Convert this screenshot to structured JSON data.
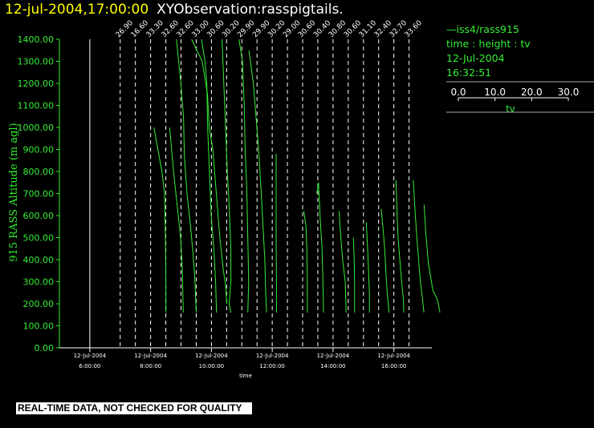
{
  "header": {
    "date_time": "12-jul-2004,17:00:00",
    "observation": "XYObservation:rasspigtails."
  },
  "legend": {
    "series_label": "iss4/rass915",
    "axes_desc": "time : height : tv",
    "date": "12-Jul-2004",
    "time": "16:32:51",
    "scale_ticks": [
      "0.0",
      "10.0",
      "20.0",
      "30.0"
    ],
    "scale_label": "tv"
  },
  "warning": "REAL-TIME DATA, NOT CHECKED FOR QUALITY",
  "colors": {
    "background": "#000000",
    "axes": "#33ee33",
    "data": "#33ee33",
    "header_date": "#ffff00",
    "text": "#ffffff"
  },
  "chart_data": {
    "type": "line",
    "title": "12-jul-2004,17:00:00 XYObservation:rasspigtails.",
    "xlabel": "time",
    "ylabel": "915 RASS Altitude (m agl)",
    "ylim": [
      0,
      1400
    ],
    "y_ticks": [
      "0.00",
      "100.00",
      "200.00",
      "300.00",
      "400.00",
      "500.00",
      "600.00",
      "700.00",
      "800.00",
      "900.00",
      "1000.00",
      "1100.00",
      "1200.00",
      "1300.00",
      "1400.00"
    ],
    "xlim": [
      "05:00",
      "17:15"
    ],
    "x_ticks": [
      {
        "date": "12-Jul-2004",
        "time": "6:00:00"
      },
      {
        "date": "12-Jul-2004",
        "time": "8:00:00"
      },
      {
        "date": "12-Jul-2004",
        "time": "10:00:00"
      },
      {
        "date": "12-Jul-2004",
        "time": "12:00:00"
      },
      {
        "date": "12-Jul-2004",
        "time": "14:00:00"
      },
      {
        "date": "12-Jul-2004",
        "time": "16:00:00"
      }
    ],
    "reference_line_time": "06:00",
    "profiles": [
      {
        "time": "07:00",
        "label": "26.90",
        "points": []
      },
      {
        "time": "07:30",
        "label": "16.60",
        "points": [
          [
            10.5,
            1000
          ],
          [
            15,
            800
          ],
          [
            16.5,
            700
          ],
          [
            17,
            500
          ],
          [
            17.2,
            350
          ],
          [
            17.3,
            160
          ]
        ]
      },
      {
        "time": "08:00",
        "label": "33.30",
        "points": [
          [
            10.8,
            1000
          ],
          [
            13,
            800
          ],
          [
            15,
            650
          ],
          [
            17,
            500
          ],
          [
            18,
            350
          ],
          [
            18.5,
            160
          ]
        ]
      },
      {
        "time": "08:30",
        "label": "32.60",
        "points": [
          [
            6,
            1400
          ],
          [
            8.5,
            1200
          ],
          [
            10,
            1050
          ],
          [
            10.5,
            870
          ],
          [
            12,
            700
          ],
          [
            14,
            550
          ],
          [
            15.5,
            420
          ],
          [
            16.5,
            300
          ],
          [
            17.2,
            160
          ]
        ]
      },
      {
        "time": "09:00",
        "label": "32.60",
        "points": [
          [
            6,
            1400
          ],
          [
            12,
            1300
          ],
          [
            15,
            1150
          ],
          [
            16,
            1000
          ],
          [
            18,
            900
          ],
          [
            20,
            700
          ],
          [
            22,
            500
          ],
          [
            24,
            350
          ],
          [
            25,
            300
          ],
          [
            26,
            200
          ]
        ]
      },
      {
        "time": "09:30",
        "label": "33.00",
        "points": [
          [
            3,
            1400
          ],
          [
            5,
            1300
          ],
          [
            6,
            1200
          ],
          [
            6.5,
            1000
          ],
          [
            7.5,
            800
          ],
          [
            8.5,
            600
          ],
          [
            10,
            450
          ],
          [
            11,
            300
          ],
          [
            11.5,
            160
          ]
        ]
      },
      {
        "time": "10:00",
        "label": "30.60",
        "points": [
          [
            6,
            1400
          ],
          [
            7,
            1200
          ],
          [
            8,
            1000
          ],
          [
            9,
            800
          ],
          [
            10,
            650
          ],
          [
            11,
            450
          ],
          [
            11,
            300
          ],
          [
            10,
            200
          ],
          [
            11,
            160
          ]
        ]
      },
      {
        "time": "10:30",
        "label": "30.20",
        "points": [
          [
            7,
            1400
          ],
          [
            9,
            1300
          ],
          [
            10,
            1100
          ],
          [
            10.5,
            900
          ],
          [
            11.5,
            700
          ],
          [
            12,
            500
          ],
          [
            12.5,
            300
          ],
          [
            12,
            160
          ]
        ]
      },
      {
        "time": "11:00",
        "label": "29.90",
        "points": [
          [
            4,
            1350
          ],
          [
            6.5,
            1200
          ],
          [
            8,
            1050
          ],
          [
            9.5,
            900
          ],
          [
            11,
            700
          ],
          [
            12,
            550
          ],
          [
            13,
            400
          ],
          [
            13.5,
            250
          ],
          [
            14,
            160
          ]
        ]
      },
      {
        "time": "11:30",
        "label": "29.90",
        "points": [
          [
            10.8,
            880
          ],
          [
            10.8,
            700
          ],
          [
            10.8,
            500
          ],
          [
            11,
            300
          ],
          [
            11,
            160
          ]
        ]
      },
      {
        "time": "12:00",
        "label": "30.20",
        "points": []
      },
      {
        "time": "12:30",
        "label": "29.00",
        "points": [
          [
            9.3,
            620
          ],
          [
            10.5,
            550
          ],
          [
            11,
            450
          ],
          [
            11.2,
            350
          ],
          [
            11.3,
            160
          ]
        ]
      },
      {
        "time": "13:00",
        "label": "30.60",
        "points": [
          [
            8,
            700
          ],
          [
            9,
            750
          ],
          [
            10,
            580
          ],
          [
            11,
            450
          ],
          [
            11.5,
            300
          ],
          [
            11.8,
            160
          ]
        ]
      },
      {
        "time": "13:30",
        "label": "30.40",
        "points": [
          [
            12,
            620
          ],
          [
            13,
            500
          ],
          [
            14,
            400
          ],
          [
            15.5,
            300
          ],
          [
            16,
            160
          ]
        ]
      },
      {
        "time": "14:00",
        "label": "30.80",
        "points": [
          [
            11.5,
            500
          ],
          [
            12,
            400
          ],
          [
            12.2,
            300
          ],
          [
            12.2,
            160
          ]
        ]
      },
      {
        "time": "14:30",
        "label": "30.60",
        "points": [
          [
            10.2,
            570
          ],
          [
            11,
            450
          ],
          [
            11.5,
            350
          ],
          [
            12,
            250
          ],
          [
            12,
            160
          ]
        ]
      },
      {
        "time": "15:00",
        "label": "31.10",
        "points": [
          [
            10,
            630
          ],
          [
            11,
            550
          ],
          [
            12,
            450
          ],
          [
            13,
            300
          ],
          [
            14,
            200
          ],
          [
            14.5,
            160
          ]
        ]
      },
      {
        "time": "15:30",
        "label": "32.40",
        "points": [
          [
            9.8,
            760
          ],
          [
            10.5,
            600
          ],
          [
            11,
            500
          ],
          [
            12,
            400
          ],
          [
            13,
            300
          ],
          [
            14,
            220
          ],
          [
            14.2,
            160
          ]
        ]
      },
      {
        "time": "16:00",
        "label": "32.70",
        "points": [
          [
            11,
            760
          ],
          [
            12,
            620
          ],
          [
            13,
            500
          ],
          [
            14,
            400
          ],
          [
            15,
            300
          ],
          [
            16.5,
            200
          ],
          [
            17,
            160
          ]
        ]
      },
      {
        "time": "16:30",
        "label": "33.60",
        "points": [
          [
            8.5,
            650
          ],
          [
            9.5,
            520
          ],
          [
            11,
            380
          ],
          [
            13.5,
            260
          ],
          [
            16,
            220
          ],
          [
            17.5,
            160
          ]
        ]
      }
    ]
  }
}
